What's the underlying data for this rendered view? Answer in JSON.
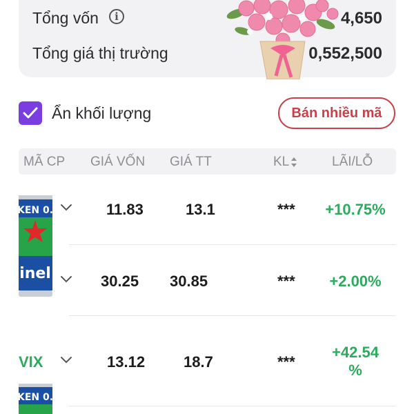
{
  "summary": {
    "total_capital_label": "Tổng vốn",
    "total_capital_value": "4,650",
    "market_value_label": "Tổng giá thị trường",
    "market_value_value": "0,552,500"
  },
  "controls": {
    "hide_volume_label": "Ẩn khối lượng",
    "hide_volume_checked": true,
    "sell_multiple_label": "Bán nhiều mã"
  },
  "table": {
    "headers": {
      "ticker": "MÃ CP",
      "cost_price": "GIÁ VỐN",
      "market_price": "GIÁ TT",
      "volume": "KL",
      "profit_loss": "LÃI/LỖ"
    },
    "rows": [
      {
        "ticker": "",
        "cost_price": "11.83",
        "market_price": "13.1",
        "volume": "***",
        "profit_loss": "+10.75%"
      },
      {
        "ticker": "",
        "cost_price": "30.25",
        "market_price": "30.85",
        "volume": "***",
        "profit_loss": "+2.00%"
      },
      {
        "ticker": "VIX",
        "cost_price": "13.12",
        "market_price": "18.7",
        "volume": "***",
        "profit_loss_line1": "+42.54",
        "profit_loss_line2": "%"
      }
    ]
  },
  "colors": {
    "accent_purple": "#7a3ee0",
    "sell_red": "#c8414a",
    "gain_green": "#2bab5c",
    "header_gray": "#8e8e93"
  }
}
